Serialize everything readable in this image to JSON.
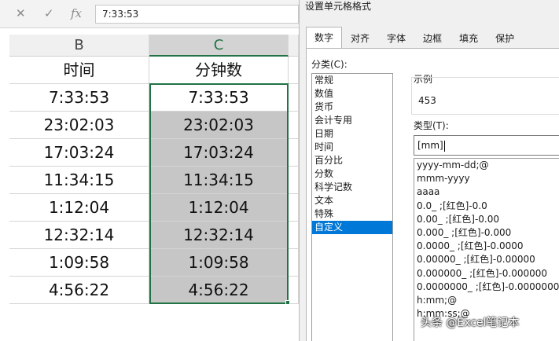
{
  "formula_bar": {
    "cancel_icon": "✕",
    "enter_icon": "✓",
    "fx_icon": "fx",
    "value": "7:33:53"
  },
  "sheet": {
    "columns": [
      {
        "letter": "B",
        "header": "时间"
      },
      {
        "letter": "C",
        "header": "分钟数"
      }
    ],
    "col_b": [
      "7:33:53",
      "23:02:03",
      "17:03:24",
      "11:34:15",
      "1:12:04",
      "12:32:14",
      "1:09:58",
      "4:56:22"
    ],
    "col_c": [
      "7:33:53",
      "23:02:03",
      "17:03:24",
      "11:34:15",
      "1:12:04",
      "12:32:14",
      "1:09:58",
      "4:56:22"
    ],
    "accent_color": "#217346",
    "selection_fill": "#c6c6c6"
  },
  "dialog": {
    "title": "设置单元格格式",
    "tabs": [
      "数字",
      "对齐",
      "字体",
      "边框",
      "填充",
      "保护"
    ],
    "active_tab": "数字",
    "category_label": "分类(C):",
    "categories": [
      "常规",
      "数值",
      "货币",
      "会计专用",
      "日期",
      "时间",
      "百分比",
      "分数",
      "科学记数",
      "文本",
      "特殊",
      "自定义"
    ],
    "selected_category": "自定义",
    "sample_label": "示例",
    "sample_value": "453",
    "type_label": "类型(T):",
    "type_value": "[mm]",
    "formats": [
      "yyyy-mm-dd;@",
      "mmm-yyyy",
      "aaaa",
      "0.0_ ;[红色]-0.0",
      "0.00_ ;[红色]-0.00",
      "0.000_ ;[红色]-0.000",
      "0.0000_ ;[红色]-0.0000",
      "0.00000_ ;[红色]-0.00000",
      "0.000000_ ;[红色]-0.000000",
      "0.0000000_ ;[红色]-0.0000000",
      "h:mm;@",
      "h:mm:ss;@"
    ],
    "selection_color": "#0078d7"
  },
  "watermark": "头条 @Excel笔记本"
}
